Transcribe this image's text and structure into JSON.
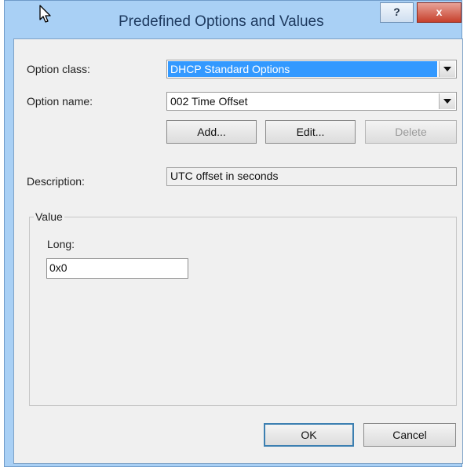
{
  "window": {
    "title": "Predefined Options and Values",
    "help_label": "?",
    "close_label": "x"
  },
  "form": {
    "option_class_label": "Option class:",
    "option_class_value": "DHCP Standard Options",
    "option_name_label": "Option name:",
    "option_name_value": "002 Time Offset",
    "add_label": "Add...",
    "edit_label": "Edit...",
    "delete_label": "Delete",
    "description_label": "Description:",
    "description_value": "UTC offset in seconds"
  },
  "value_group": {
    "legend": "Value",
    "long_label": "Long:",
    "long_value": "0x0"
  },
  "footer": {
    "ok_label": "OK",
    "cancel_label": "Cancel"
  },
  "icons": {
    "cursor": "mouse-pointer-icon",
    "dropdown": "chevron-down-icon"
  },
  "colors": {
    "titlebar": "#a9d0f5",
    "selection": "#3399ff",
    "close_button": "#c7402c",
    "client_bg": "#f0f0f0"
  }
}
